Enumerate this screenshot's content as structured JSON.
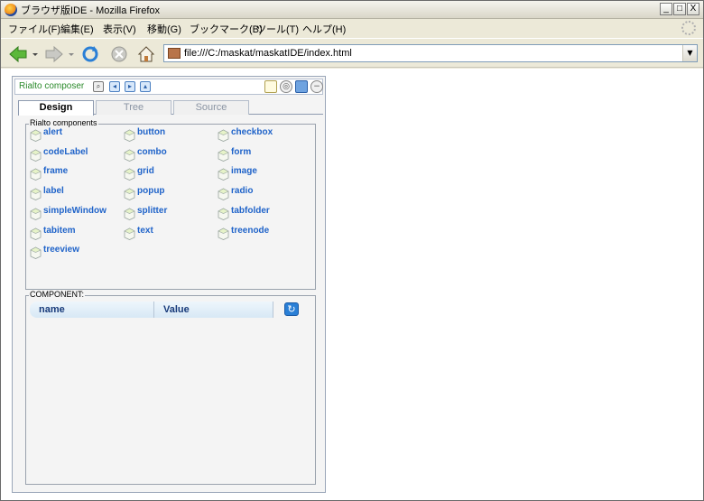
{
  "window": {
    "title": "ブラウザ版IDE - Mozilla Firefox",
    "min": "_",
    "max": "□",
    "close": "X"
  },
  "menu": [
    "ファイル(F)",
    "編集(E)",
    "表示(V)",
    "移動(G)",
    "ブックマーク(B)",
    "ツール(T)",
    "ヘルプ(H)"
  ],
  "address": {
    "url": "file:///C:/maskat/maskatIDE/index.html"
  },
  "composer": {
    "title": "Rialto composer",
    "tabs": [
      "Design",
      "Tree",
      "Source"
    ],
    "components_legend": "Rialto components",
    "components": [
      "alert",
      "button",
      "checkbox",
      "codeLabel",
      "combo",
      "form",
      "frame",
      "grid",
      "image",
      "label",
      "popup",
      "radio",
      "simpleWindow",
      "splitter",
      "tabfolder",
      "tabitem",
      "text",
      "treenode",
      "treeview"
    ],
    "component_legend": "COMPONENT:",
    "table_headers": {
      "name": "name",
      "value": "Value"
    }
  },
  "colors": {
    "link": "#1f63c9",
    "title_green": "#2b8a2b"
  }
}
